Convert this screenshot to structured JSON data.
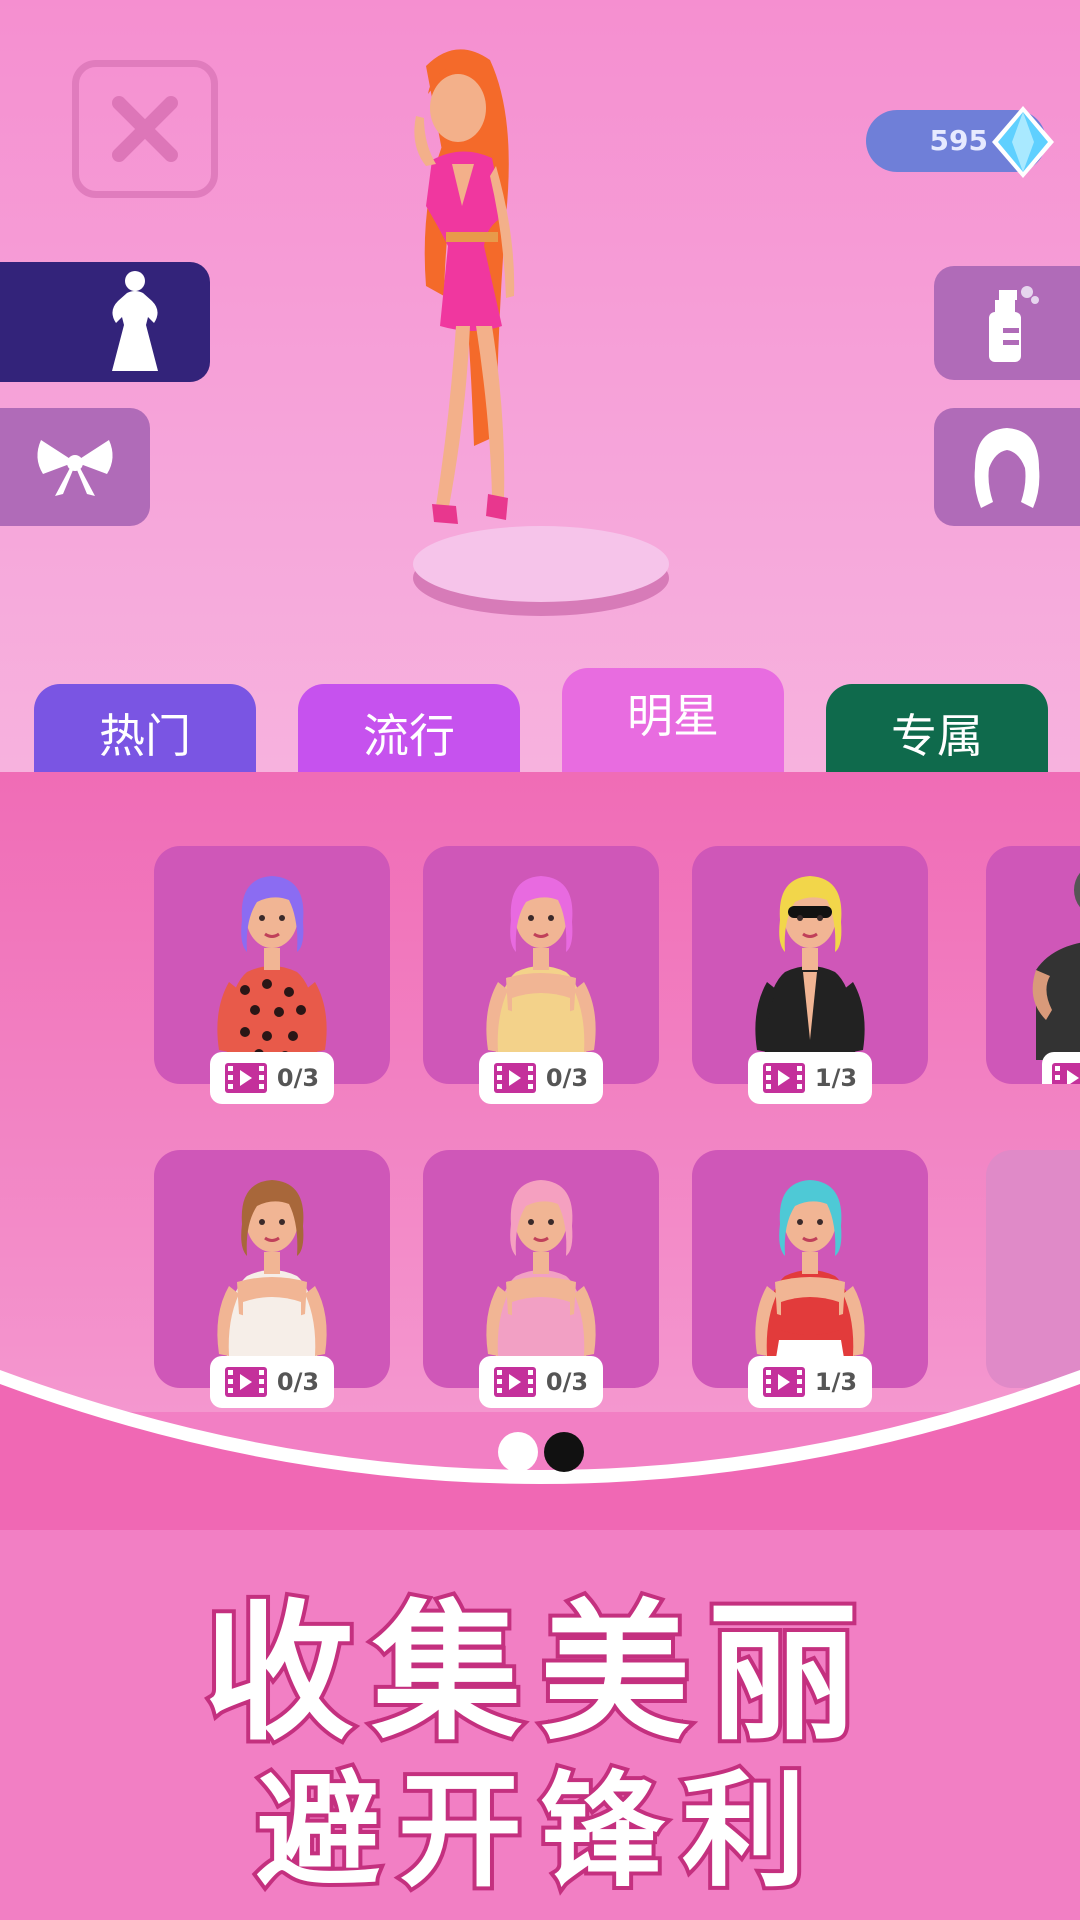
{
  "currency": {
    "gems": "595"
  },
  "icons": {
    "close": "close-icon",
    "gem": "diamond-icon",
    "outfit": "dress-silhouette-icon",
    "accessory": "bow-icon",
    "spray": "spray-bottle-icon",
    "hair": "hair-icon",
    "video": "video-icon"
  },
  "tabs": [
    {
      "label": "热门",
      "selected": false
    },
    {
      "label": "流行",
      "selected": false
    },
    {
      "label": "明星",
      "selected": true
    },
    {
      "label": "专属",
      "selected": false
    }
  ],
  "items": [
    {
      "progress": "0/3",
      "hair": "#8b6cf2",
      "outfit": "#e85a4a",
      "style": "polka"
    },
    {
      "progress": "0/3",
      "hair": "#e86ae0",
      "outfit": "#f3d28a",
      "style": "top"
    },
    {
      "progress": "1/3",
      "hair": "#f2d64a",
      "outfit": "#222222",
      "style": "suit"
    },
    {
      "progress": "",
      "hair": "#555555",
      "outfit": "#333333",
      "style": "partial"
    },
    {
      "progress": "0/3",
      "hair": "#a8673a",
      "outfit": "#f6eee8",
      "style": "top"
    },
    {
      "progress": "0/3",
      "hair": "#f5a0c0",
      "outfit": "#f2a0c4",
      "style": "top"
    },
    {
      "progress": "1/3",
      "hair": "#4ec9d6",
      "outfit": "#e23b3b",
      "style": "bikini"
    }
  ],
  "pager": {
    "pages": 2,
    "current": 2
  },
  "slogan": {
    "line1": "收集美丽",
    "line2": "避开锋利"
  },
  "colors": {
    "background": "#f27fc4",
    "tab_hot": "#7a55e3",
    "tab_pop": "#c652ee",
    "tab_star": "#e86ce0",
    "tab_exclusive": "#0f6a4c",
    "card": "#cf57b8",
    "slogan_stroke": "#c4307f"
  }
}
